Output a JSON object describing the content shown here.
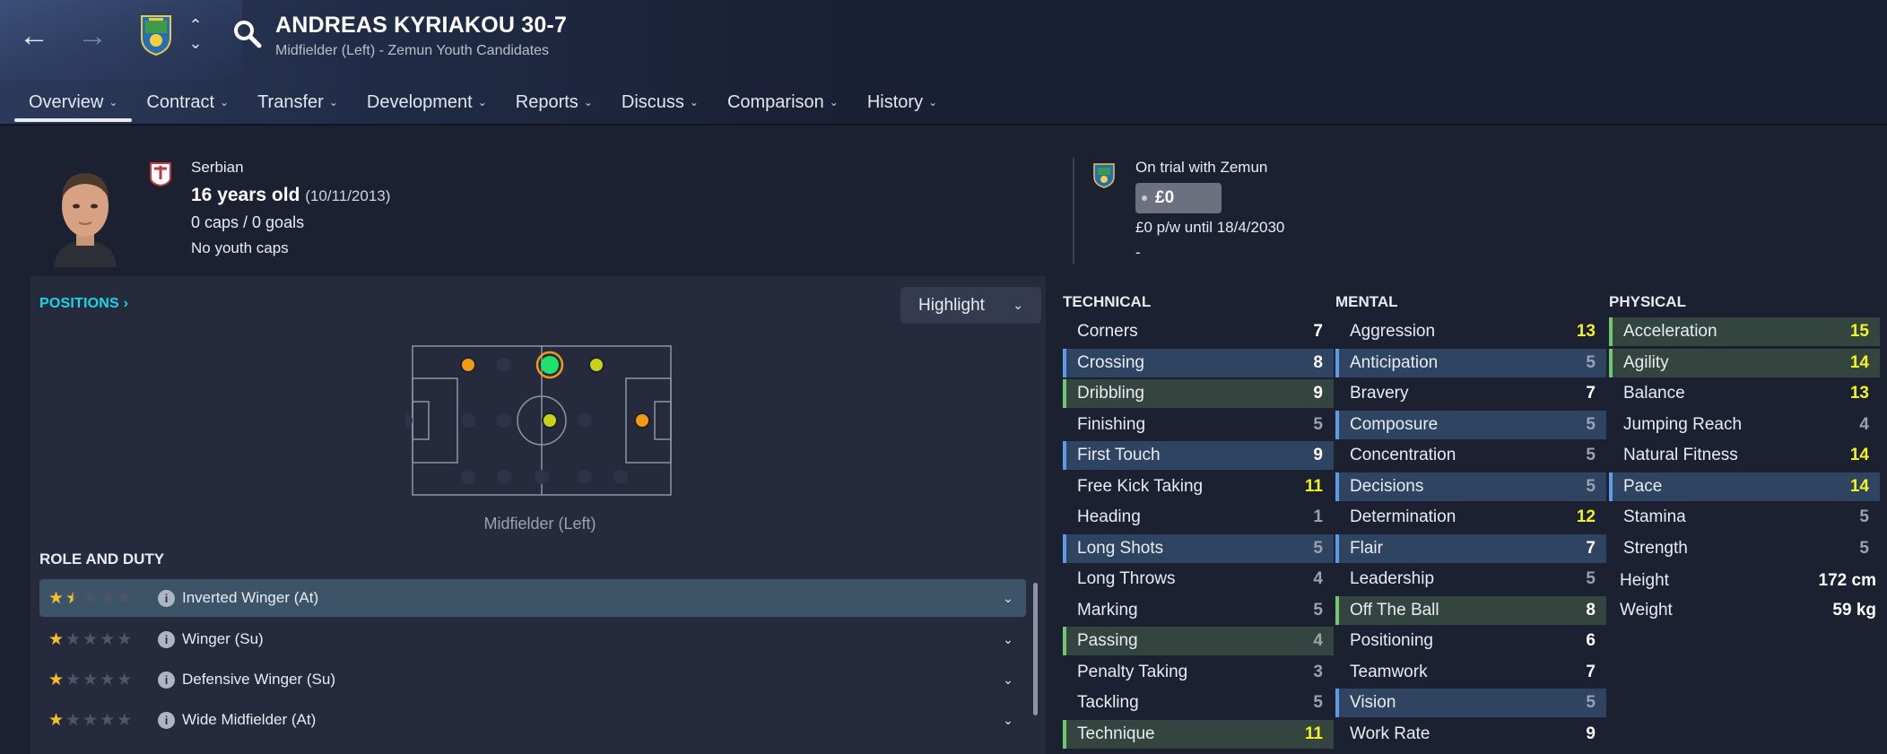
{
  "header": {
    "player_name": "ANDREAS KYRIAKOU 30-7",
    "subtitle": "Midfielder (Left) - Zemun Youth Candidates"
  },
  "tabs": [
    {
      "label": "Overview"
    },
    {
      "label": "Contract"
    },
    {
      "label": "Transfer"
    },
    {
      "label": "Development"
    },
    {
      "label": "Reports"
    },
    {
      "label": "Discuss"
    },
    {
      "label": "Comparison"
    },
    {
      "label": "History"
    }
  ],
  "profile": {
    "nationality": "Serbian",
    "age": "16 years old",
    "dob": "(10/11/2013)",
    "caps": "0 caps / 0 goals",
    "youth_caps": "No youth caps"
  },
  "contract": {
    "status": "On trial with Zemun",
    "value": "£0",
    "wage": "£0 p/w until 18/4/2030",
    "extra": "-"
  },
  "positions": {
    "title": "POSITIONS",
    "highlight_label": "Highlight",
    "position_label": "Midfielder (Left)"
  },
  "role_duty": {
    "title": "ROLE AND DUTY",
    "roles": [
      {
        "name": "Inverted Winger (At)",
        "stars": 1.5,
        "selected": true
      },
      {
        "name": "Winger (Su)",
        "stars": 1,
        "selected": false
      },
      {
        "name": "Defensive Winger (Su)",
        "stars": 1,
        "selected": false
      },
      {
        "name": "Wide Midfielder (At)",
        "stars": 1,
        "selected": false
      }
    ]
  },
  "attributes": {
    "technical": {
      "title": "TECHNICAL",
      "items": [
        {
          "name": "Corners",
          "value": "7",
          "hl": ""
        },
        {
          "name": "Crossing",
          "value": "8",
          "hl": "b"
        },
        {
          "name": "Dribbling",
          "value": "9",
          "hl": "g"
        },
        {
          "name": "Finishing",
          "value": "5",
          "hl": ""
        },
        {
          "name": "First Touch",
          "value": "9",
          "hl": "b"
        },
        {
          "name": "Free Kick Taking",
          "value": "11",
          "hl": ""
        },
        {
          "name": "Heading",
          "value": "1",
          "hl": ""
        },
        {
          "name": "Long Shots",
          "value": "5",
          "hl": "b"
        },
        {
          "name": "Long Throws",
          "value": "4",
          "hl": ""
        },
        {
          "name": "Marking",
          "value": "5",
          "hl": ""
        },
        {
          "name": "Passing",
          "value": "4",
          "hl": "g"
        },
        {
          "name": "Penalty Taking",
          "value": "3",
          "hl": ""
        },
        {
          "name": "Tackling",
          "value": "5",
          "hl": ""
        },
        {
          "name": "Technique",
          "value": "11",
          "hl": "g"
        }
      ]
    },
    "mental": {
      "title": "MENTAL",
      "items": [
        {
          "name": "Aggression",
          "value": "13",
          "hl": ""
        },
        {
          "name": "Anticipation",
          "value": "5",
          "hl": "b"
        },
        {
          "name": "Bravery",
          "value": "7",
          "hl": ""
        },
        {
          "name": "Composure",
          "value": "5",
          "hl": "b"
        },
        {
          "name": "Concentration",
          "value": "5",
          "hl": ""
        },
        {
          "name": "Decisions",
          "value": "5",
          "hl": "b"
        },
        {
          "name": "Determination",
          "value": "12",
          "hl": ""
        },
        {
          "name": "Flair",
          "value": "7",
          "hl": "b"
        },
        {
          "name": "Leadership",
          "value": "5",
          "hl": ""
        },
        {
          "name": "Off The Ball",
          "value": "8",
          "hl": "g"
        },
        {
          "name": "Positioning",
          "value": "6",
          "hl": ""
        },
        {
          "name": "Teamwork",
          "value": "7",
          "hl": ""
        },
        {
          "name": "Vision",
          "value": "5",
          "hl": "b"
        },
        {
          "name": "Work Rate",
          "value": "9",
          "hl": ""
        }
      ]
    },
    "physical": {
      "title": "PHYSICAL",
      "items": [
        {
          "name": "Acceleration",
          "value": "15",
          "hl": "g"
        },
        {
          "name": "Agility",
          "value": "14",
          "hl": "g"
        },
        {
          "name": "Balance",
          "value": "13",
          "hl": ""
        },
        {
          "name": "Jumping Reach",
          "value": "4",
          "hl": ""
        },
        {
          "name": "Natural Fitness",
          "value": "14",
          "hl": ""
        },
        {
          "name": "Pace",
          "value": "14",
          "hl": "b"
        },
        {
          "name": "Stamina",
          "value": "5",
          "hl": ""
        },
        {
          "name": "Strength",
          "value": "5",
          "hl": ""
        }
      ]
    },
    "bio": [
      {
        "name": "Height",
        "value": "172 cm"
      },
      {
        "name": "Weight",
        "value": "59 kg"
      }
    ]
  }
}
